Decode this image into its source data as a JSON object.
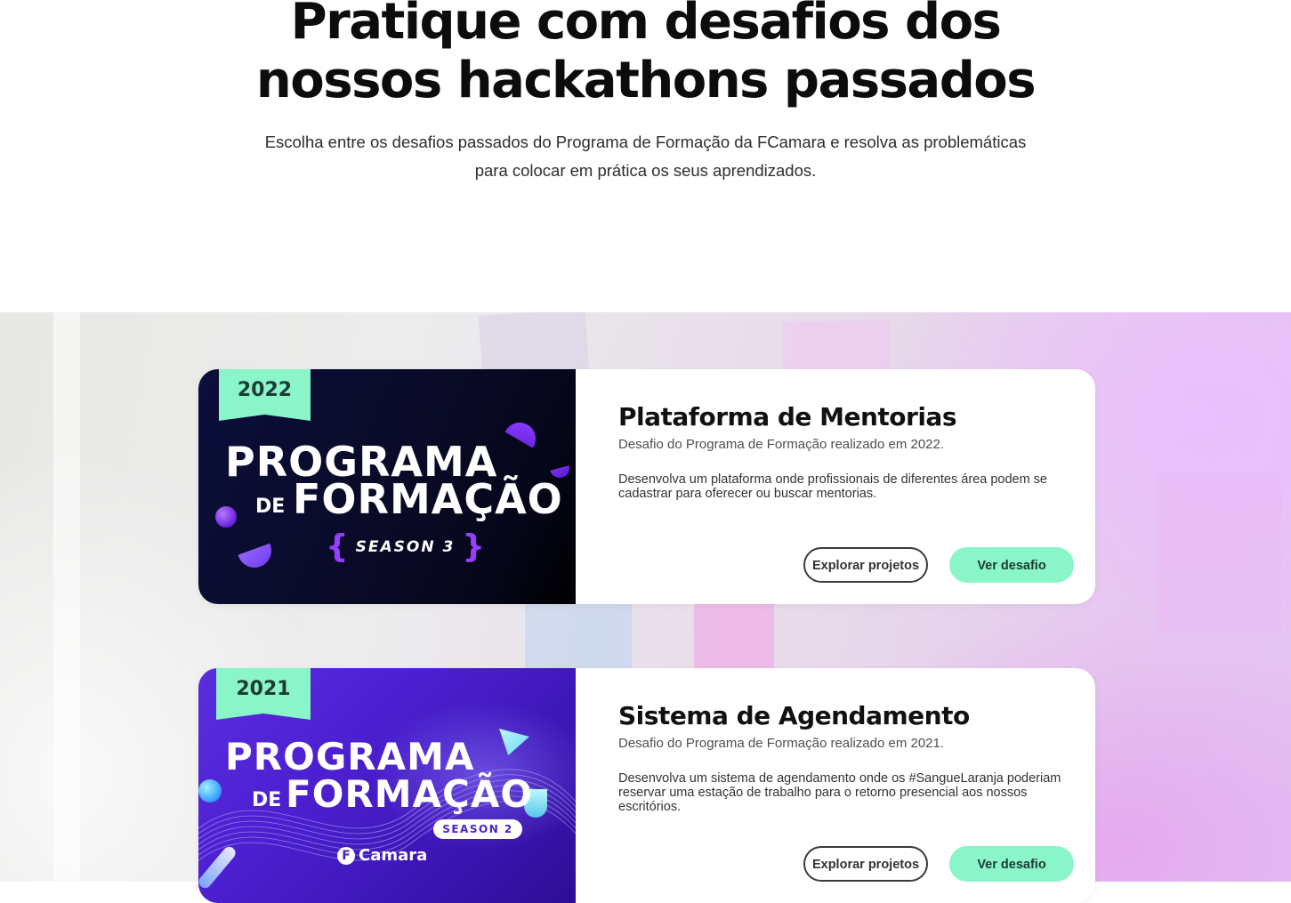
{
  "hero": {
    "title_line1": "Pratique com desafios dos",
    "title_line2": "nossos hackathons passados",
    "subtitle_line1": "Escolha entre os desafios passados do Programa de Formação da FCamara e resolva as problemáticas",
    "subtitle_line2": "para colocar em prática os seus aprendizados."
  },
  "challenges": [
    {
      "year": "2022",
      "image": {
        "line1": "PROGRAMA",
        "line2_small": "DE",
        "line2": "FORMAÇÃO",
        "season": "SEASON 3",
        "brace_open": "{",
        "brace_close": "}"
      },
      "title": "Plataforma de Mentorias",
      "meta": "Desafio do Programa de Formação realizado em 2022.",
      "description_line1": "Desenvolva um plataforma onde profissionais de diferentes área podem se",
      "description_line2": "cadastrar para oferecer ou buscar mentorias.",
      "description_line3": "",
      "explore_label": "Explorar projetos",
      "view_label": "Ver desafio"
    },
    {
      "year": "2021",
      "image": {
        "line1": "PROGRAMA",
        "line2_small": "DE",
        "line2": "FORMAÇÃO",
        "season": "SEASON 2",
        "brand_mark": "F",
        "brand_name": "Camara"
      },
      "title": "Sistema de Agendamento",
      "meta": "Desafio do Programa de Formação realizado em 2021.",
      "description_line1": "Desenvolva um sistema de agendamento onde os #SangueLaranja poderiam",
      "description_line2": "reservar uma estação de trabalho para o retorno presencial aos nossos",
      "description_line3": "escritórios.",
      "explore_label": "Explorar projetos",
      "view_label": "Ver desafio"
    }
  ],
  "colors": {
    "accent_green": "#8af5c9",
    "title_text": "#111111",
    "season_brace": "#9b3dff"
  }
}
